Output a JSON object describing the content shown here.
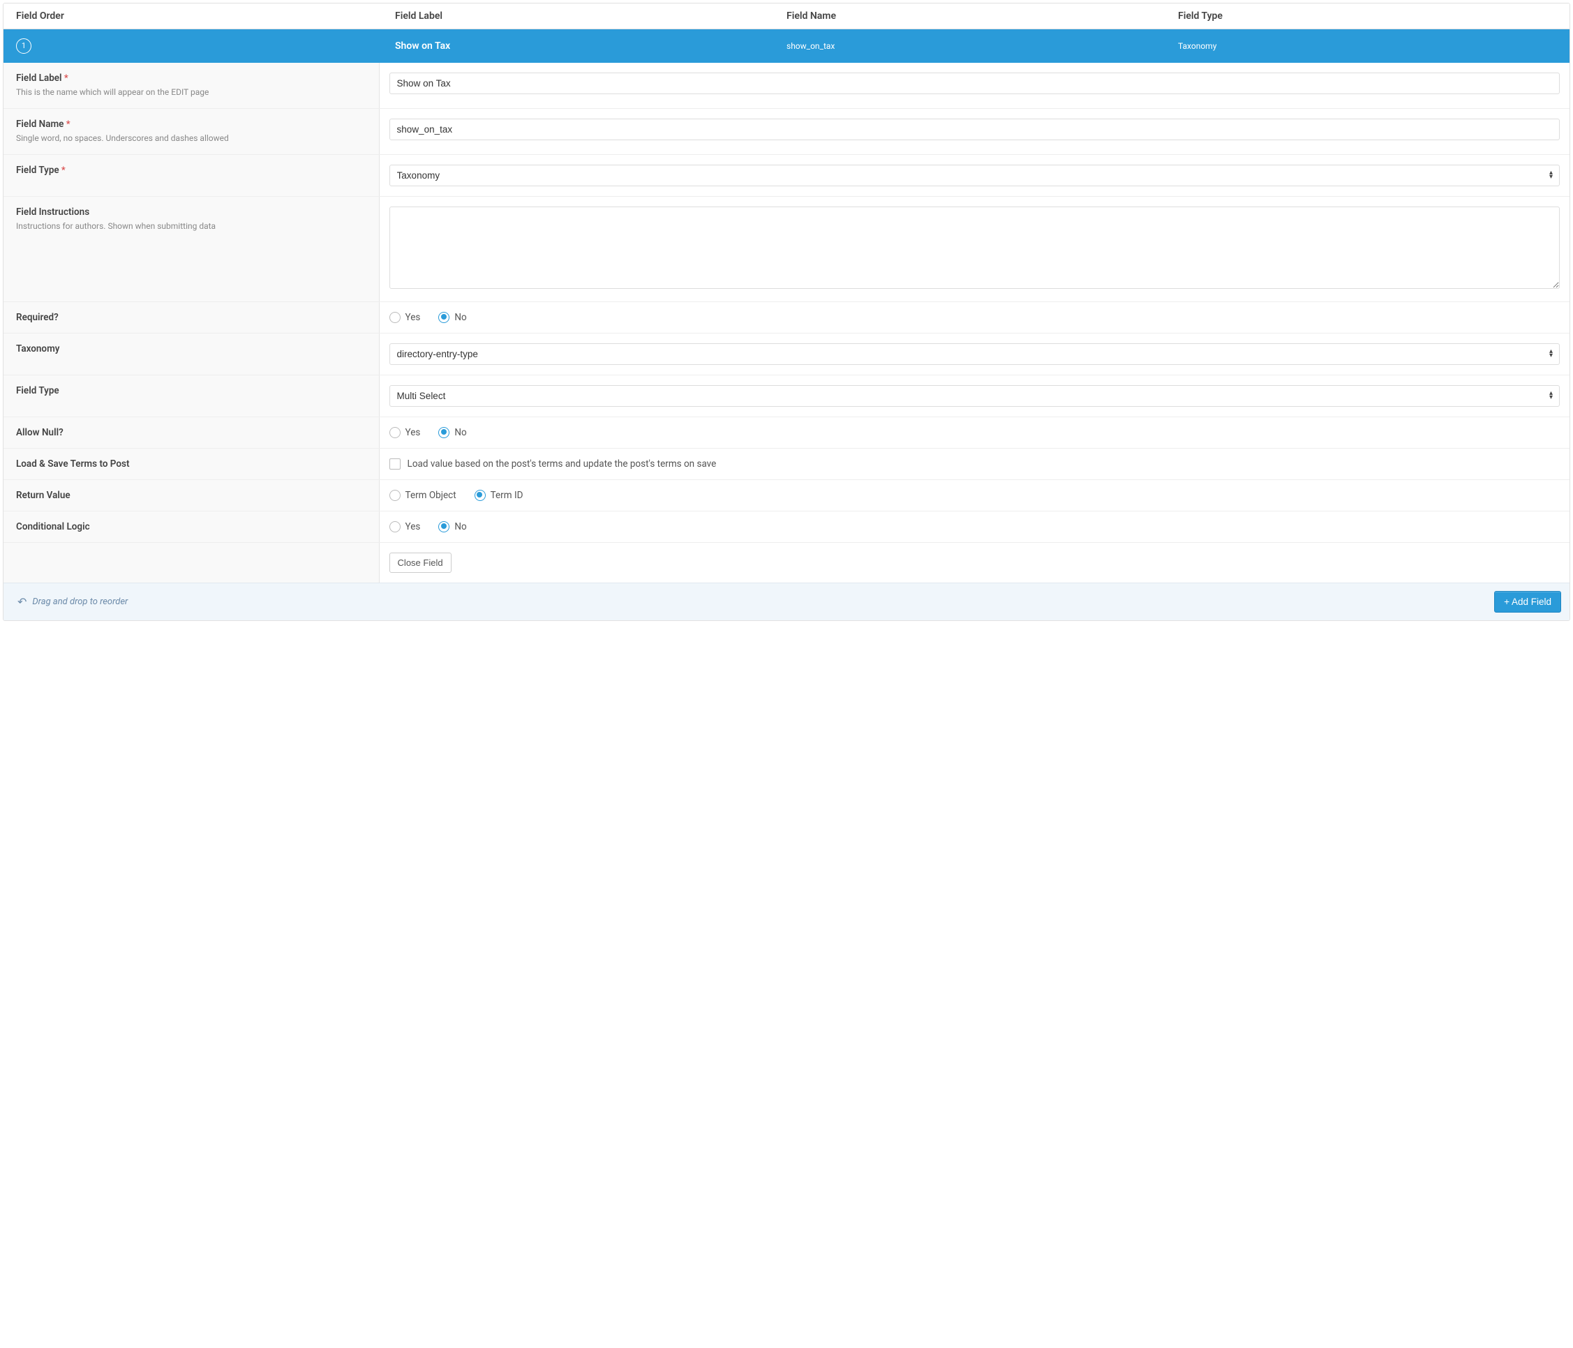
{
  "header": {
    "order": "Field Order",
    "label": "Field Label",
    "name": "Field Name",
    "type": "Field Type"
  },
  "field_bar": {
    "order_num": "1",
    "label": "Show on Tax",
    "name": "show_on_tax",
    "type": "Taxonomy"
  },
  "rows": {
    "field_label": {
      "label": "Field Label",
      "required_mark": "*",
      "desc": "This is the name which will appear on the EDIT page",
      "value": "Show on Tax"
    },
    "field_name": {
      "label": "Field Name",
      "required_mark": "*",
      "desc": "Single word, no spaces. Underscores and dashes allowed",
      "value": "show_on_tax"
    },
    "field_type": {
      "label": "Field Type",
      "required_mark": "*",
      "selected": "Taxonomy"
    },
    "instructions": {
      "label": "Field Instructions",
      "desc": "Instructions for authors. Shown when submitting data",
      "value": ""
    },
    "required": {
      "label": "Required?",
      "options": {
        "yes": "Yes",
        "no": "No"
      },
      "selected": "no"
    },
    "taxonomy": {
      "label": "Taxonomy",
      "selected": "directory-entry-type"
    },
    "field_type2": {
      "label": "Field Type",
      "selected": "Multi Select"
    },
    "allow_null": {
      "label": "Allow Null?",
      "options": {
        "yes": "Yes",
        "no": "No"
      },
      "selected": "no"
    },
    "load_save": {
      "label": "Load & Save Terms to Post",
      "option_label": "Load value based on the post's terms and update the post's terms on save",
      "checked": false
    },
    "return_value": {
      "label": "Return Value",
      "options": {
        "term_object": "Term Object",
        "term_id": "Term ID"
      },
      "selected": "term_id"
    },
    "conditional_logic": {
      "label": "Conditional Logic",
      "options": {
        "yes": "Yes",
        "no": "No"
      },
      "selected": "no"
    },
    "close_field": "Close Field"
  },
  "footer": {
    "reorder_tip": "Drag and drop to reorder",
    "add_field": "+ Add Field"
  }
}
